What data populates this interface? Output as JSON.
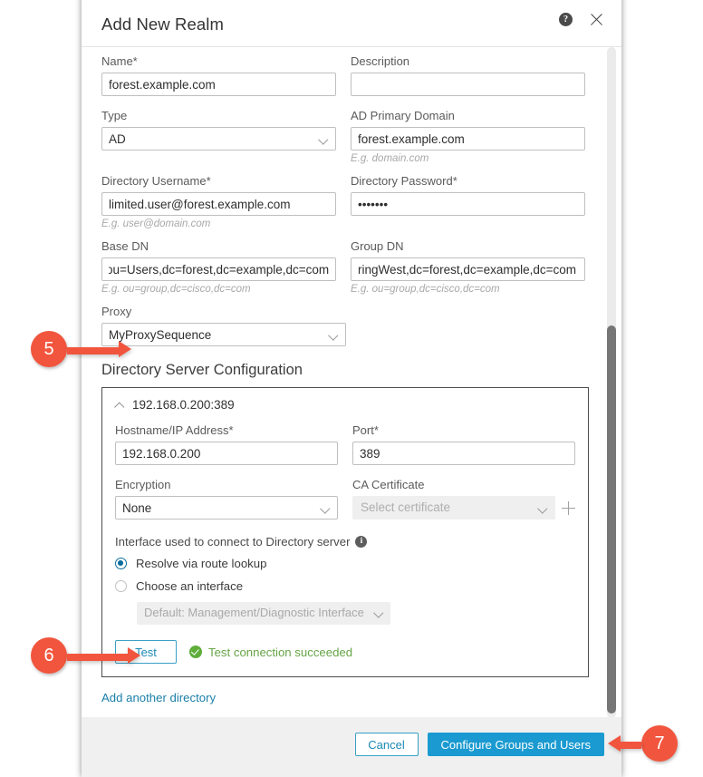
{
  "dialog": {
    "title": "Add New Realm",
    "help_icon": "help-circle-icon",
    "close_icon": "close-icon"
  },
  "form": {
    "name": {
      "label": "Name*",
      "value": "forest.example.com"
    },
    "description": {
      "label": "Description",
      "value": ""
    },
    "type": {
      "label": "Type",
      "value": "AD"
    },
    "ad_primary_domain": {
      "label": "AD Primary Domain",
      "value": "forest.example.com",
      "hint": "E.g. domain.com"
    },
    "directory_username": {
      "label": "Directory Username*",
      "value": "limited.user@forest.example.com",
      "hint": "E.g. user@domain.com"
    },
    "directory_password": {
      "label": "Directory Password*",
      "value": "•••••••"
    },
    "base_dn": {
      "label": "Base DN",
      "value": "ou=Users,dc=forest,dc=example,dc=com",
      "hint": "E.g. ou=group,dc=cisco,dc=com"
    },
    "group_dn": {
      "label": "Group DN",
      "value": "ringWest,dc=forest,dc=example,dc=com",
      "hint": "E.g. ou=group,dc=cisco,dc=com"
    },
    "proxy": {
      "label": "Proxy",
      "value": "MyProxySequence"
    }
  },
  "directory_server": {
    "section_title": "Directory Server Configuration",
    "panel_header": "192.168.0.200:389",
    "collapse_icon": "chevron-up-icon",
    "hostname": {
      "label": "Hostname/IP Address*",
      "value": "192.168.0.200"
    },
    "port": {
      "label": "Port*",
      "value": "389"
    },
    "encryption": {
      "label": "Encryption",
      "value": "None"
    },
    "ca_certificate": {
      "label": "CA Certificate",
      "placeholder": "Select certificate",
      "add_icon": "plus-icon"
    },
    "interface": {
      "label": "Interface used to connect to Directory server",
      "info_icon": "info-icon",
      "options": [
        {
          "label": "Resolve via route lookup",
          "selected": true
        },
        {
          "label": "Choose an interface",
          "selected": false
        }
      ],
      "interface_select_value": "Default: Management/Diagnostic Interface"
    },
    "test_button": "Test",
    "test_status": "Test connection succeeded",
    "test_status_icon": "check-circle-icon",
    "add_another": "Add another directory"
  },
  "footer": {
    "cancel_label": "Cancel",
    "primary_label": "Configure Groups and Users"
  },
  "callouts": [
    {
      "number": "5"
    },
    {
      "number": "6"
    },
    {
      "number": "7"
    }
  ],
  "colors": {
    "accent_blue": "#1a9ad0",
    "link_blue": "#1a7fa8",
    "success_green": "#66a447",
    "callout_red": "#f2553d",
    "radio_blue": "#0d6e9e"
  }
}
